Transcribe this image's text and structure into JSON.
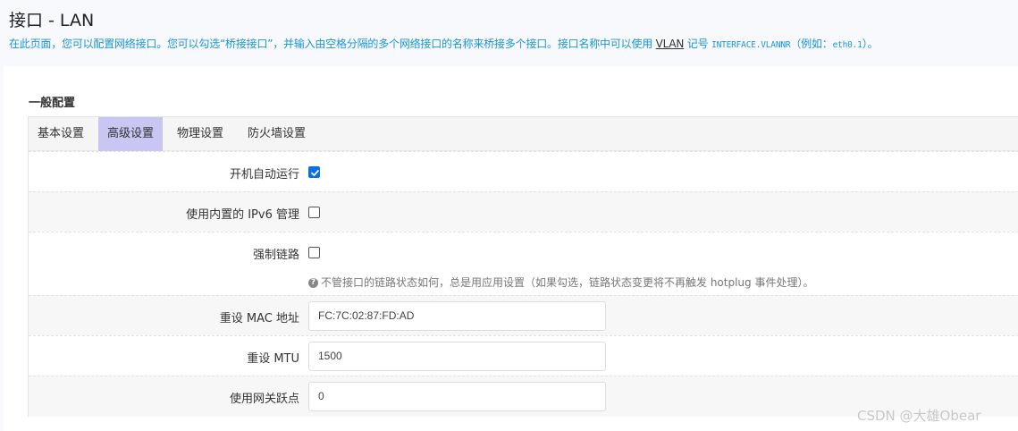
{
  "header": {
    "title": "接口 - LAN",
    "desc_before": "在此页面，您可以配置网络接口。您可以勾选“桥接接口”，并输入由空格分隔的多个网络接口的名称来桥接多个接口。接口名称中可以使用 ",
    "desc_link": "VLAN",
    "desc_middle": " 记号 ",
    "desc_mono1": "INTERFACE.VLANNR",
    "desc_paren": "（例如：",
    "desc_mono2": "eth0.1",
    "desc_end": "）。"
  },
  "section": {
    "title": "一般配置"
  },
  "tabs": [
    {
      "label": "基本设置",
      "active": false
    },
    {
      "label": "高级设置",
      "active": true
    },
    {
      "label": "物理设置",
      "active": false
    },
    {
      "label": "防火墙设置",
      "active": false
    }
  ],
  "fields": {
    "autostart": {
      "label": "开机自动运行",
      "checked": true
    },
    "ipv6": {
      "label": "使用内置的 IPv6 管理",
      "checked": false
    },
    "force_link": {
      "label": "强制链路",
      "checked": false,
      "hint": "不管接口的链路状态如何，总是用应用设置（如果勾选，链路状态变更将不再触发 hotplug 事件处理）。"
    },
    "mac": {
      "label": "重设 MAC 地址",
      "value": "FC:7C:02:87:FD:AD"
    },
    "mtu": {
      "label": "重设 MTU",
      "value": "1500"
    },
    "metric": {
      "label": "使用网关跃点",
      "value": "0"
    }
  },
  "watermark": "CSDN @大雄Obear",
  "colors": {
    "accent": "#1a94d4",
    "active_tab": "#c9c6f3",
    "checkbox": "#0b6ee6"
  }
}
